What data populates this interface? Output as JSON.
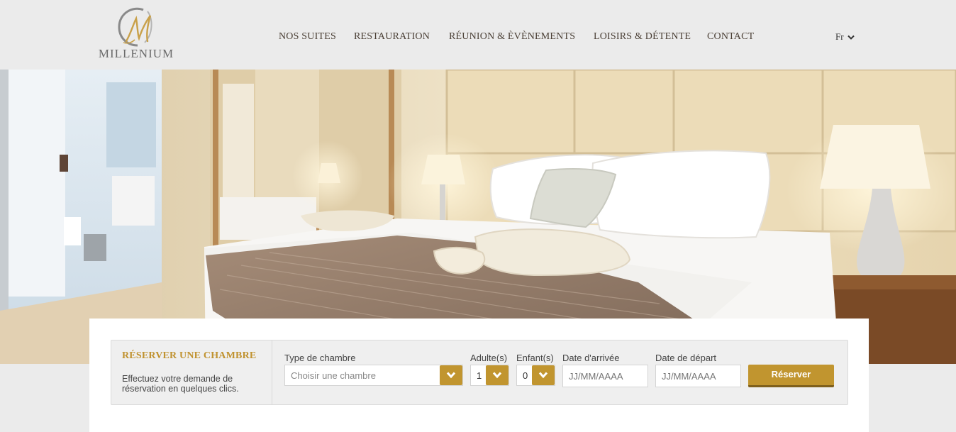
{
  "brand": {
    "logo_text": "MILLENIUM",
    "accent_color": "#c1952f"
  },
  "nav": {
    "items": [
      {
        "label": "NOS SUITES"
      },
      {
        "label": "RESTAURATION"
      },
      {
        "label": "RÉUNION & ÈVÈNEMENTS"
      },
      {
        "label": "LOISIRS & DÉTENTE"
      },
      {
        "label": "CONTACT"
      }
    ],
    "language": "Fr",
    "language_icon": "chevron-down-icon"
  },
  "hero": {
    "image": "hotel-room-photo"
  },
  "booking": {
    "title": "RÉSERVER UNE CHAMBRE",
    "description": "Effectuez votre demande de réservation en quelques clics.",
    "room_type": {
      "label": "Type de chambre",
      "placeholder": "Choisir une chambre"
    },
    "adults": {
      "label": "Adulte(s)",
      "value": "1"
    },
    "children": {
      "label": "Enfant(s)",
      "value": "0"
    },
    "arrival": {
      "label": "Date d'arrivée",
      "placeholder": "JJ/MM/AAAA"
    },
    "departure": {
      "label": "Date de départ",
      "placeholder": "JJ/MM/AAAA"
    },
    "submit_label": "Réserver"
  }
}
